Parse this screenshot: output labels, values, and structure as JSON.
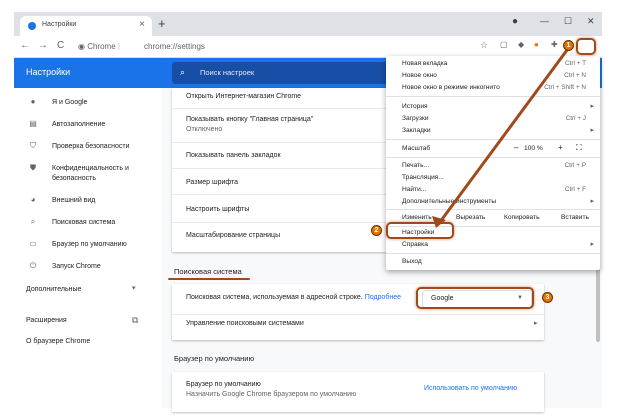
{
  "browser": {
    "tab_title": "Настройки",
    "tab_close": "×",
    "new_tab": "+",
    "minimize": "—",
    "maximize": "☐",
    "close": "✕",
    "back": "←",
    "forward": "→",
    "reload": "C",
    "site_label": "Chrome",
    "url": "chrome://settings",
    "accent": "#1a73e8"
  },
  "header": {
    "title": "Настройки",
    "search_placeholder": "Поиск настроек"
  },
  "sidebar": {
    "items": [
      {
        "label": "Я и Google",
        "icon": "person-icon"
      },
      {
        "label": "Автозаполнение",
        "icon": "form-icon"
      },
      {
        "label": "Проверка безопасности",
        "icon": "shield-icon"
      },
      {
        "label": "Конфиденциальность и безопасность",
        "icon": "shield-lock-icon"
      },
      {
        "label": "Внешний вид",
        "icon": "palette-icon"
      },
      {
        "label": "Поисковая система",
        "icon": "search-icon"
      },
      {
        "label": "Браузер по умолчанию",
        "icon": "browser-icon"
      },
      {
        "label": "Запуск Chrome",
        "icon": "power-icon"
      }
    ],
    "advanced": "Дополнительные",
    "extensions": "Расширения",
    "about": "О браузере Chrome"
  },
  "main": {
    "appearance_rows": [
      "Открыть Интернет-магазин Chrome",
      "Показывать кнопку \"Главная страница\"",
      "Показывать панель закладок",
      "Размер шрифта",
      "Настроить шрифты",
      "Масштабирование страницы"
    ],
    "home_button_sub": "Отключено",
    "search_section_title": "Поисковая система",
    "search_engine_label": "Поисковая система, используемая в адресной строке.",
    "search_engine_link": "Подробнее",
    "search_engine_value": "Google",
    "manage_engines": "Управление поисковыми системами",
    "default_browser_title": "Браузер по умолчанию",
    "default_browser_label": "Браузер по умолчанию",
    "default_browser_sub": "Назначить Google Chrome браузером по умолчанию",
    "default_browser_button": "Использовать по умолчанию"
  },
  "menu": {
    "new_tab": {
      "label": "Новая вкладка",
      "shortcut": "Ctrl + T"
    },
    "new_window": {
      "label": "Новое окно",
      "shortcut": "Ctrl + N"
    },
    "incognito": {
      "label": "Новое окно в режиме инкогнито",
      "shortcut": "Ctrl + Shift + N"
    },
    "history": {
      "label": "История"
    },
    "downloads": {
      "label": "Загрузки",
      "shortcut": "Ctrl + J"
    },
    "bookmarks": {
      "label": "Закладки"
    },
    "zoom": {
      "label": "Масштаб",
      "minus": "–",
      "value": "100 %",
      "plus": "+",
      "fullscreen": "⛶"
    },
    "print": {
      "label": "Печать...",
      "shortcut": "Ctrl + P"
    },
    "cast": {
      "label": "Трансляция..."
    },
    "find": {
      "label": "Найти...",
      "shortcut": "Ctrl + F"
    },
    "more_tools": {
      "label": "Дополнительные инструменты"
    },
    "edit": {
      "label": "Изменить",
      "cut": "Вырезать",
      "copy": "Копировать",
      "paste": "Вставить"
    },
    "settings": {
      "label": "Настройки"
    },
    "help": {
      "label": "Справка"
    },
    "exit": {
      "label": "Выход"
    }
  },
  "annotations": [
    "1",
    "2",
    "3"
  ]
}
